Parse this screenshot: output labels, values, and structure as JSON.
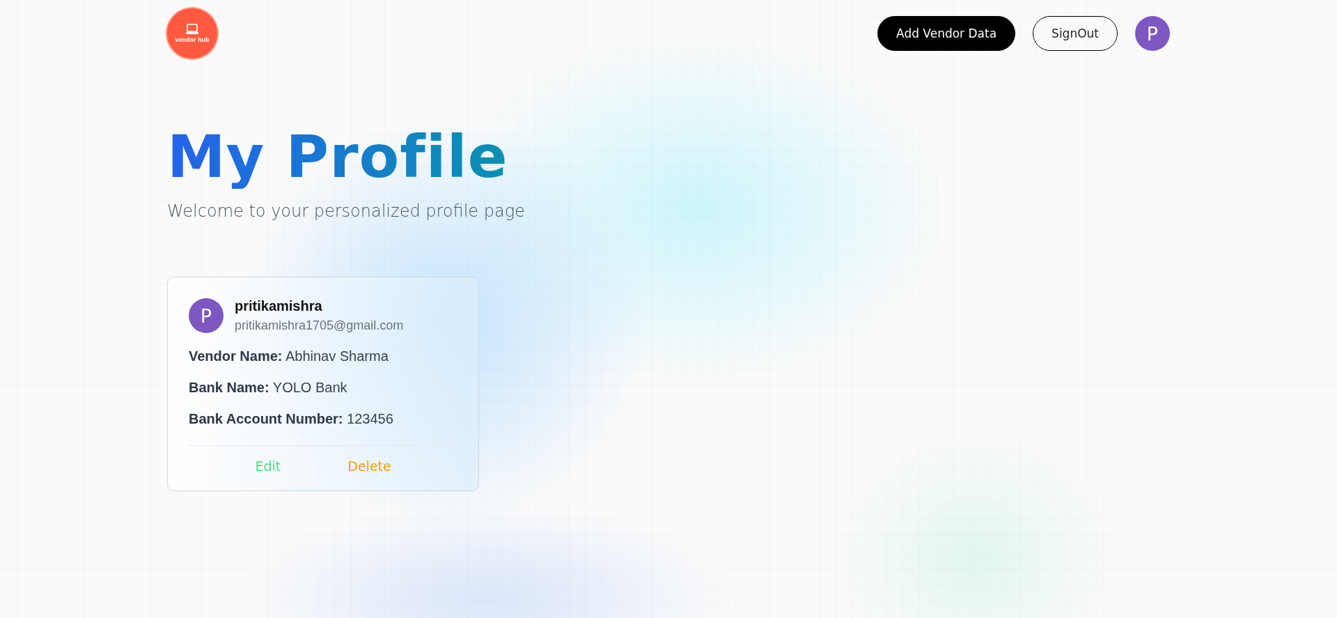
{
  "header": {
    "logo": {
      "text": "vendor hub"
    },
    "buttons": [
      {
        "label": "Add Vendor Data",
        "kind": "primary"
      },
      {
        "label": "SignOut",
        "kind": "outline"
      }
    ],
    "avatar": {
      "initial": "P"
    }
  },
  "title": "My Profile",
  "subtitle": "Welcome to your personalized profile page",
  "card": {
    "avatar": {
      "initial": "P"
    },
    "username": "pritikamishra",
    "email": "pritikamishra1705@gmail.com",
    "fields": [
      "**Vendor Name:** Abhinav Sharma",
      "**Bank Name:** YOLO Bank",
      "**Bank Account Number:** 123456"
    ],
    "actions": [
      {
        "label": "Edit",
        "kind": "edit"
      },
      {
        "label": "Delete",
        "kind": "delete"
      }
    ]
  }
}
